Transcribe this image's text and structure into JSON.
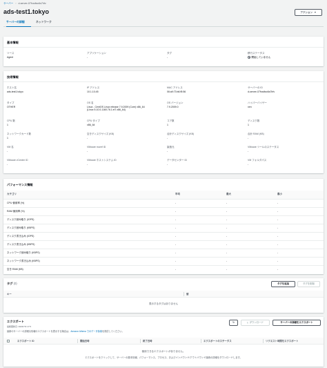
{
  "breadcrumb": {
    "root": "サーバー",
    "current": "d-server-07fxxdtsx6s7hfv"
  },
  "page": {
    "title": "ads-test1.tokyo",
    "actions_label": "アクション",
    "actions_icon": "caret-down-icon"
  },
  "tabs": [
    {
      "label": "サーバーの詳細"
    },
    {
      "label": "ネットワーク"
    }
  ],
  "basic": {
    "title": "基本情報",
    "fields": [
      {
        "label": "ソース",
        "value": "Agent"
      },
      {
        "label": "アプリケーション",
        "value": "-"
      },
      {
        "label": "タグ",
        "value": "-"
      },
      {
        "label": "移行ステータス",
        "value": "開始していません"
      }
    ]
  },
  "tech": {
    "title": "技術情報",
    "fields": [
      {
        "label": "ホスト名",
        "value": "ads-test1.tokyo"
      },
      {
        "label": "IP アドレス",
        "value": "10.1.10.45"
      },
      {
        "label": "MAC アドレス",
        "value": "06:a9:73:b6:f5:56"
      },
      {
        "label": "サーバーの ID",
        "value": "d-server-07fxxdtsx6s7hfv"
      },
      {
        "label": "タイプ",
        "value": "OTHER"
      },
      {
        "label": "OS 名",
        "value": "Linux - CentOS Linux release 7.9.2009 (Core) x86_64",
        "value2": "(Linux 5.10.0-1160.76.1.el7.x86_64)"
      },
      {
        "label": "OS バージョン",
        "value": "7.9.2009.0"
      },
      {
        "label": "ハイパーバイザー",
        "value": "xen"
      },
      {
        "label": "CPU 数",
        "value": "1"
      },
      {
        "label": "CPU タイプ",
        "value": "x86_64"
      },
      {
        "label": "コア数",
        "value": "1"
      },
      {
        "label": "ディスク数",
        "value": "1"
      },
      {
        "label": "ネットワークカード数",
        "value": "1"
      },
      {
        "label": "空きディスクサイズ (KB)",
        "value": "-"
      },
      {
        "label": "合計ディスクサイズ (KB)",
        "value": "-"
      },
      {
        "label": "合計 RAM (KB)",
        "value": "-"
      },
      {
        "label": "VM 名",
        "value": "-"
      },
      {
        "label": "VMware moref ID",
        "value": "-"
      },
      {
        "label": "製造元",
        "value": "-"
      },
      {
        "label": "VMware ツールのステータス",
        "value": "-"
      },
      {
        "label": "VMware vCenter ID",
        "value": "-"
      },
      {
        "label": "VMware ホストシステム ID",
        "value": "-"
      },
      {
        "label": "データセンター ID",
        "value": "-"
      },
      {
        "label": "VM フォルダパス",
        "value": "-"
      }
    ]
  },
  "perf": {
    "title": "パフォーマンス情報",
    "headers": [
      "カテゴリ",
      "平均",
      "最大",
      "最小"
    ],
    "rows": [
      {
        "cat": "CPU 使用率 (%)",
        "avg": "-",
        "max": "-",
        "min": "-"
      },
      {
        "cat": "RAM 使用率 (%)",
        "avg": "-",
        "max": "-",
        "min": "-"
      },
      {
        "cat": "ディスク読み取り (IOPS)",
        "avg": "-",
        "max": "-",
        "min": "-"
      },
      {
        "cat": "ディスク読み取り (KBPS)",
        "avg": "-",
        "max": "-",
        "min": "-"
      },
      {
        "cat": "ディスク書き込み (IOPS)",
        "avg": "-",
        "max": "-",
        "min": "-"
      },
      {
        "cat": "ディスク書き込み (KBPS)",
        "avg": "-",
        "max": "-",
        "min": "-"
      },
      {
        "cat": "ネットワーク読み取り (KBPS)",
        "avg": "-",
        "max": "-",
        "min": "-"
      },
      {
        "cat": "ネットワーク書き込み (KBPS)",
        "avg": "-",
        "max": "-",
        "min": "-"
      },
      {
        "cat": "空き RAM (KB)",
        "avg": "-",
        "max": "-",
        "min": "-"
      }
    ]
  },
  "tags": {
    "title": "タグ",
    "count": "(0)",
    "add_label": "タグを追加",
    "delete_label": "タグを削除",
    "col_key": "キー",
    "col_value": "値",
    "empty": "表示するタグはありません"
  },
  "export": {
    "title": "エクスポート",
    "subtitle": "最終更新日: 2023/7/3 17:5",
    "note_prefix": "最新のサーバーの詳細な情報のエクスポートを表示する場合は、",
    "note_link": "Amazon Athena でのデータ探索",
    "note_suffix": "を検討してください。",
    "refresh_icon": "refresh-icon",
    "download_label": "ダウンロード",
    "download_icon": "download-icon",
    "export_label": "サーバーの詳細をエクスポート",
    "columns": [
      "エクスポート ID",
      "開始日時",
      "終了日時",
      "エクスポートのステータス",
      "リクエスト時間をエクスポート"
    ],
    "empty": "使用できるエクスポートがありません。",
    "empty_hint": "エクスポートをクリックして、サーバーの基本情報、パフォーマンス、プロセス、およびインバウンド/アウトバウンド接続の詳細をダウンロードします。"
  }
}
